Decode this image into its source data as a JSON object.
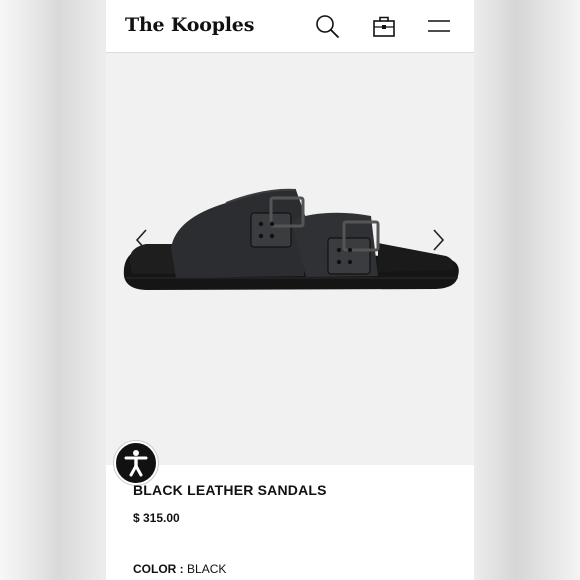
{
  "header": {
    "brand": "The Kooples",
    "icons": [
      "search-icon",
      "shopping-bag-icon",
      "menu-icon"
    ]
  },
  "gallery": {
    "image": "black-leather-sandal-product-photo",
    "prev_icon": "chevron-left-icon",
    "next_icon": "chevron-right-icon"
  },
  "accessibility": {
    "icon": "accessibility-icon"
  },
  "product": {
    "title": "BLACK LEATHER SANDALS",
    "price": "$ 315.00",
    "color_label": "COLOR :",
    "color_value": "BLACK"
  },
  "colors": {
    "text": "#111111",
    "background": "#ffffff",
    "image_background": "#f1f1f1"
  }
}
